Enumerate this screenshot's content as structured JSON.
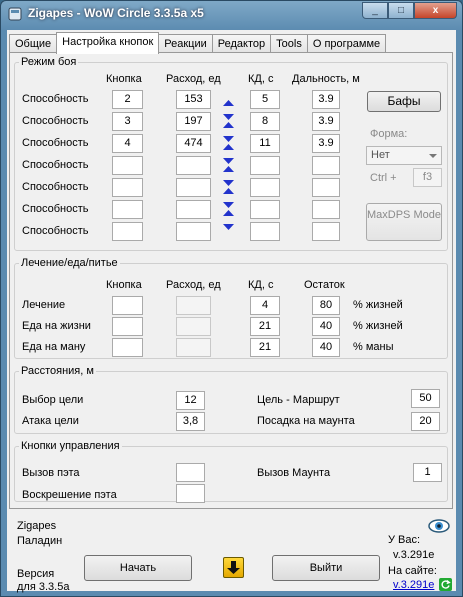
{
  "window": {
    "title": "Zigapes - WoW Circle 3.3.5a x5",
    "controls": [
      "_",
      "□",
      "x"
    ]
  },
  "tabs": [
    "Общие",
    "Настройка кнопок",
    "Реакции",
    "Редактор",
    "Tools",
    "О программе"
  ],
  "combat": {
    "legend": "Режим боя",
    "headers": {
      "key": "Кнопка",
      "cost": "Расход, ед",
      "cd": "КД, с",
      "range": "Дальность, м"
    },
    "rows": [
      {
        "label": "Способность",
        "key": "2",
        "cost": "153",
        "cd": "5",
        "range": "3.9"
      },
      {
        "label": "Способность",
        "key": "3",
        "cost": "197",
        "cd": "8",
        "range": "3.9"
      },
      {
        "label": "Способность",
        "key": "4",
        "cost": "474",
        "cd": "11",
        "range": "3.9"
      },
      {
        "label": "Способность",
        "key": "",
        "cost": "",
        "cd": "",
        "range": ""
      },
      {
        "label": "Способность",
        "key": "",
        "cost": "",
        "cd": "",
        "range": ""
      },
      {
        "label": "Способность",
        "key": "",
        "cost": "",
        "cd": "",
        "range": ""
      },
      {
        "label": "Способность",
        "key": "",
        "cost": "",
        "cd": "",
        "range": ""
      }
    ],
    "buffs_button": "Бафы",
    "form_label": "Форма:",
    "form_value": "Нет",
    "ctrl_label": "Ctrl +",
    "ctrl_key": "f3",
    "maxdps_button": "MaxDPS Mode"
  },
  "healing": {
    "legend": "Лечение/еда/питье",
    "headers": {
      "key": "Кнопка",
      "cost": "Расход, ед",
      "cd": "КД, с",
      "rest": "Остаток"
    },
    "rows": [
      {
        "label": "Лечение",
        "key": "",
        "cost": "",
        "cd": "4",
        "rest": "80",
        "unit": "% жизней"
      },
      {
        "label": "Еда на жизни",
        "key": "",
        "cost": "",
        "cd": "21",
        "rest": "40",
        "unit": "% жизней"
      },
      {
        "label": "Еда на ману",
        "key": "",
        "cost": "",
        "cd": "21",
        "rest": "40",
        "unit": "% маны"
      }
    ]
  },
  "distances": {
    "legend": "Расстояния, м",
    "target_select_label": "Выбор цели",
    "target_select": "12",
    "target_attack_label": "Атака цели",
    "target_attack": "3,8",
    "route_label": "Цель - Маршрут",
    "route": "50",
    "mount_label": "Посадка на маунта",
    "mount": "20"
  },
  "controls": {
    "legend": "Кнопки управления",
    "pet_call_label": "Вызов пэта",
    "pet_call": "",
    "pet_revive_label": "Воскрешение пэта",
    "pet_revive": "",
    "mount_call_label": "Вызов Маунта",
    "mount_call": "1"
  },
  "footer": {
    "char_name": "Zigapes",
    "char_class": "Паладин",
    "version_line1": "Версия",
    "version_line2": "для 3.3.5а",
    "start_button": "Начать",
    "exit_button": "Выйти",
    "have_label": "У Вас:",
    "have_version": "v.3.291e",
    "site_label": "На сайте:",
    "site_version": "v.3.291e"
  },
  "colors": {
    "arrow": "#2233cc",
    "link": "#0000cc",
    "start_arrow_bg": "#f5c400",
    "ok_badge": "#22aa33"
  }
}
